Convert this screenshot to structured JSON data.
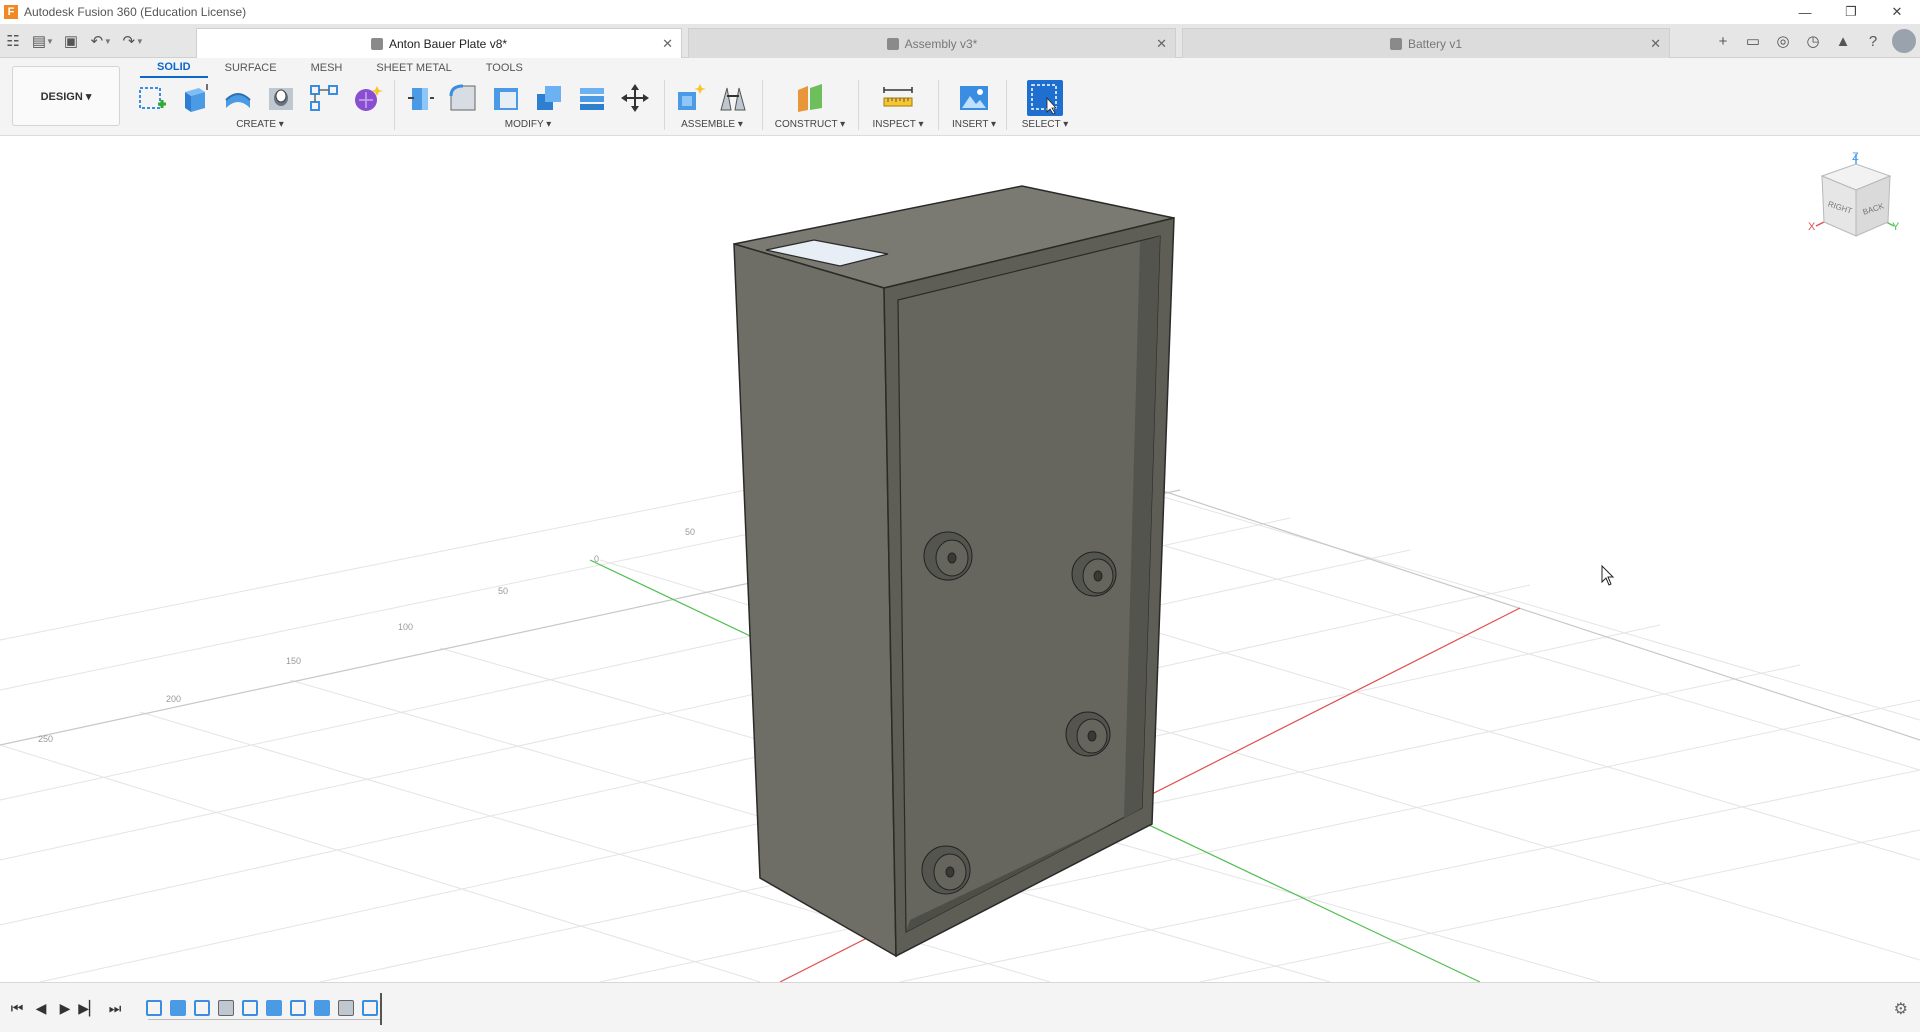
{
  "window": {
    "title": "Autodesk Fusion 360 (Education License)",
    "logo_letter": "F",
    "controls": [
      "—",
      "❐",
      "✕"
    ]
  },
  "quick_access": {
    "grid_icon": "☷",
    "file_icon": "▤",
    "save_icon": "▣",
    "undo_icon": "↶",
    "redo_icon": "↷"
  },
  "tabs": [
    {
      "label": "Anton Bauer Plate v8*",
      "active": true
    },
    {
      "label": "Assembly v3*",
      "active": false
    },
    {
      "label": "Battery v1",
      "active": false
    }
  ],
  "tab_close": "✕",
  "right_icons": {
    "new_tab": "+",
    "chat": "▭",
    "online": "◎",
    "history": "◷",
    "notifications": "▲",
    "help": "?"
  },
  "workspace_tabs": [
    "SOLID",
    "SURFACE",
    "MESH",
    "SHEET METAL",
    "TOOLS"
  ],
  "design_button": "DESIGN ▾",
  "groups": {
    "create": "CREATE ▾",
    "modify": "MODIFY ▾",
    "assemble": "ASSEMBLE ▾",
    "construct": "CONSTRUCT ▾",
    "inspect": "INSPECT ▾",
    "insert": "INSERT ▾",
    "select": "SELECT ▾"
  },
  "viewcube": {
    "axis_z": "Z",
    "axis_x": "X",
    "axis_y": "Y",
    "face_right": "RIGHT",
    "face_back": "BACK"
  },
  "grid_labels": [
    "50",
    "0",
    "50",
    "100",
    "150",
    "200",
    "250"
  ],
  "timeline": {
    "controls": [
      "⏮",
      "◀",
      "▶",
      "▶▏",
      "⏭"
    ],
    "gear_icon": "⚙"
  },
  "colors": {
    "accent": "#0a68c8",
    "body": "#6e6e66",
    "x_axis": "#e05050",
    "y_axis": "#50c050"
  }
}
